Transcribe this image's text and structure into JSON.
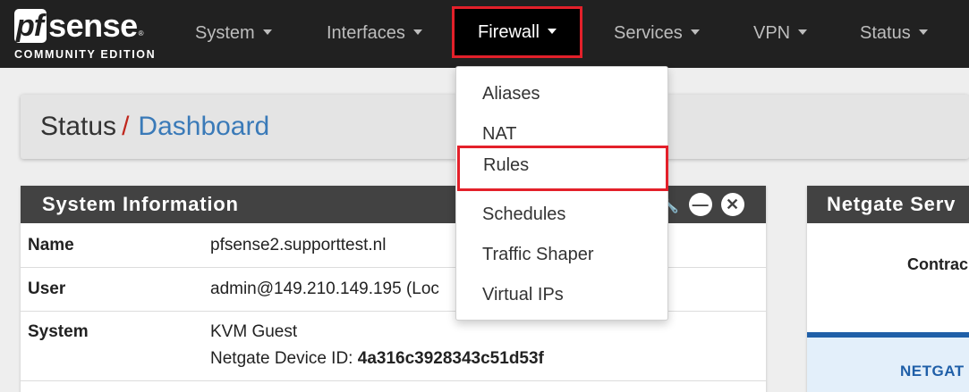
{
  "brand": {
    "logo_pf": "pf",
    "logo_sense": "sense",
    "logo_reg": "®",
    "edition": "COMMUNITY EDITION"
  },
  "nav": {
    "items": [
      {
        "label": "System"
      },
      {
        "label": "Interfaces"
      },
      {
        "label": "Firewall",
        "active": true
      },
      {
        "label": "Services"
      },
      {
        "label": "VPN"
      },
      {
        "label": "Status"
      }
    ]
  },
  "firewall_menu": {
    "items": [
      {
        "label": "Aliases"
      },
      {
        "label": "NAT"
      },
      {
        "label": "Rules",
        "highlighted": true
      },
      {
        "label": "Schedules"
      },
      {
        "label": "Traffic Shaper"
      },
      {
        "label": "Virtual IPs"
      }
    ]
  },
  "breadcrumb": {
    "parent": "Status",
    "separator": "/",
    "current": "Dashboard"
  },
  "system_info": {
    "title": "System Information",
    "rows": [
      {
        "key": "Name",
        "value": "pfsense2.supporttest.nl"
      },
      {
        "key": "User",
        "value": "admin@149.210.149.195 (Loc"
      },
      {
        "key": "System",
        "value": "KVM Guest",
        "value2_label": "Netgate Device ID: ",
        "value2": "4a316c3928343c51d53f"
      }
    ]
  },
  "netgate_panel": {
    "title": "Netgate Serv",
    "contract_label": "Contrac",
    "brand_text": "NETGAT"
  },
  "colors": {
    "navbar": "#212121",
    "highlight": "#e3202a",
    "link": "#3a7ab8",
    "separator": "#c0281e"
  },
  "icons": {
    "wrench": "wrench-icon",
    "minimize": "minus-circle-icon",
    "close": "close-circle-icon"
  }
}
